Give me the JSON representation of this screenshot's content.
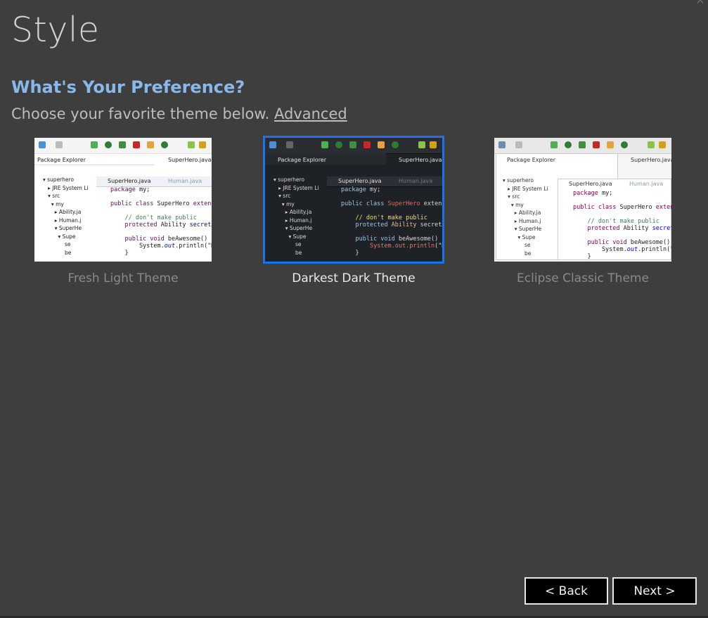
{
  "page": {
    "title": "Style",
    "heading": "What's Your Preference?",
    "subtext": "Choose your favorite theme below.",
    "advanced_link": "Advanced"
  },
  "themes": [
    {
      "label": "Fresh Light Theme",
      "selected": false
    },
    {
      "label": "Darkest Dark Theme",
      "selected": true
    },
    {
      "label": "Eclipse Classic Theme",
      "selected": false
    }
  ],
  "preview": {
    "package_explorer": "Package Explorer",
    "tab_superhero": "SuperHero.java",
    "tab_human": "Human.java",
    "tree": [
      "superhero",
      "JRE System Li",
      "src",
      "my",
      "Ability.ja",
      "Human.j",
      "SuperHe",
      "Supe",
      "se",
      "be"
    ],
    "code": [
      "package my;",
      "",
      "public class SuperHero extends",
      "",
      "    // don't make public",
      "    protected Ability secretAbi",
      "",
      "    public void beAwesome() {",
      "        System.out.println(\"My",
      "    }"
    ]
  },
  "buttons": {
    "back": "< Back",
    "next": "Next >"
  },
  "colors": {
    "background": "#3e3e3e",
    "heading": "#89b8ea",
    "selection": "#1a73e8"
  }
}
